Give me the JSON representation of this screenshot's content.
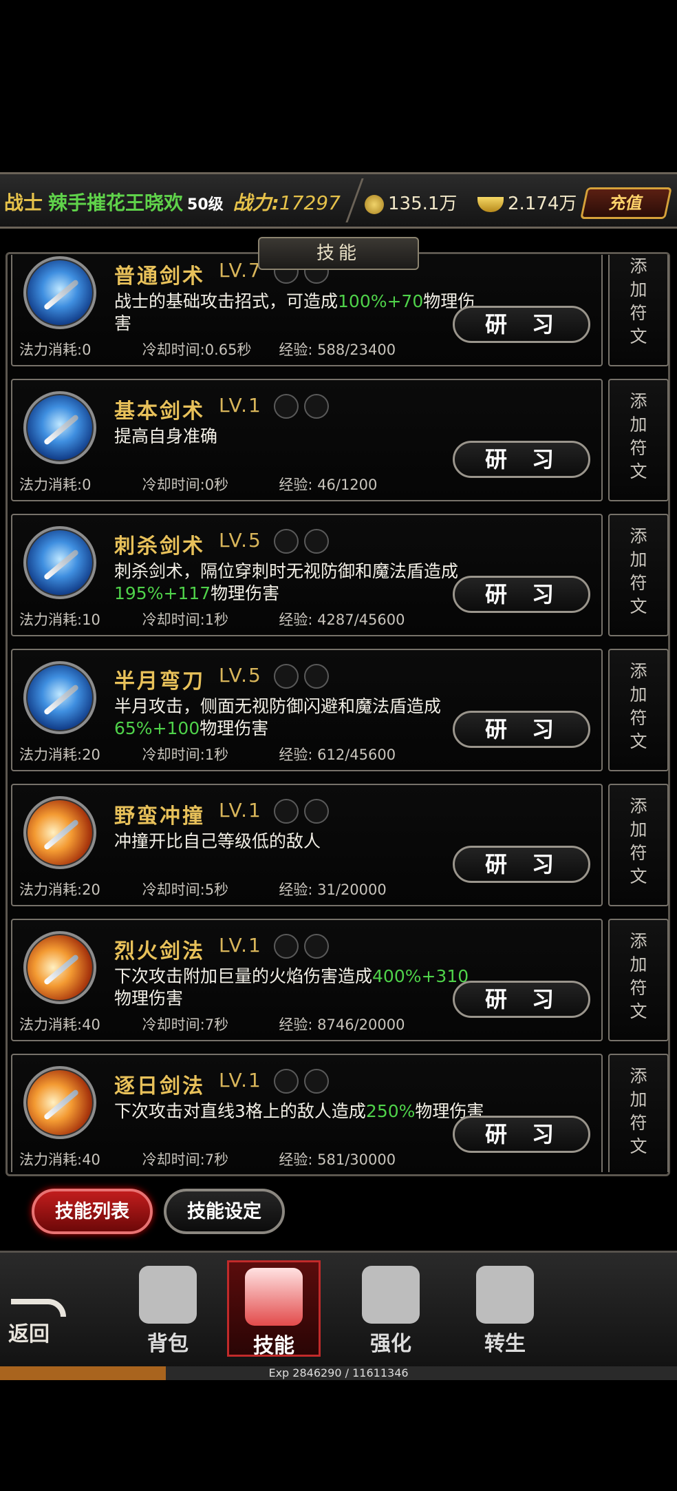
{
  "header": {
    "class_name": "战士",
    "player_name": "辣手摧花王晓欢",
    "level": "50级",
    "power_label": "战力:",
    "power_value": "17297",
    "gold": "135.1万",
    "ingot": "2.174万",
    "recharge_label": "充值"
  },
  "panel_title": "技能",
  "labels": {
    "mp_cost": "法力消耗:",
    "cooldown": "冷却时间:",
    "exp": "经验:",
    "study": "研习",
    "add_rune": "添加符文"
  },
  "skills": [
    {
      "name": "普通剑术",
      "level": "LV.7",
      "desc": [
        {
          "t": "战士的基础攻击招式，可造成"
        },
        {
          "t": "100%+70",
          "g": true
        },
        {
          "t": "物理伤害"
        }
      ],
      "mp": "0",
      "cd": "0.65秒",
      "exp": "588/23400",
      "icon": "blue"
    },
    {
      "name": "基本剑术",
      "level": "LV.1",
      "desc": [
        {
          "t": "提高自身准确"
        }
      ],
      "mp": "0",
      "cd": "0秒",
      "exp": "46/1200",
      "icon": "blue"
    },
    {
      "name": "刺杀剑术",
      "level": "LV.5",
      "desc": [
        {
          "t": "刺杀剑术，隔位穿刺时无视防御和魔法盾造成"
        },
        {
          "t": "195%+117",
          "g": true
        },
        {
          "t": "物理伤害"
        }
      ],
      "mp": "10",
      "cd": "1秒",
      "exp": "4287/45600",
      "icon": "blue"
    },
    {
      "name": "半月弯刀",
      "level": "LV.5",
      "desc": [
        {
          "t": "半月攻击，侧面无视防御闪避和魔法盾造成"
        },
        {
          "t": "65%+100",
          "g": true
        },
        {
          "t": "物理伤害"
        }
      ],
      "mp": "20",
      "cd": "1秒",
      "exp": "612/45600",
      "icon": "blue"
    },
    {
      "name": "野蛮冲撞",
      "level": "LV.1",
      "desc": [
        {
          "t": "冲撞开比自己等级低的敌人"
        }
      ],
      "mp": "20",
      "cd": "5秒",
      "exp": "31/20000",
      "icon": "orange"
    },
    {
      "name": "烈火剑法",
      "level": "LV.1",
      "desc": [
        {
          "t": "下次攻击附加巨量的火焰伤害造成"
        },
        {
          "t": "400%+310",
          "g": true
        },
        {
          "t": "物理伤害"
        }
      ],
      "mp": "40",
      "cd": "7秒",
      "exp": "8746/20000",
      "icon": "orange"
    },
    {
      "name": "逐日剑法",
      "level": "LV.1",
      "desc": [
        {
          "t": "下次攻击对直线3格上的敌人造成"
        },
        {
          "t": "250%",
          "g": true
        },
        {
          "t": "物理伤害"
        }
      ],
      "mp": "40",
      "cd": "7秒",
      "exp": "581/30000",
      "icon": "orange"
    }
  ],
  "tabs": {
    "skill_list": "技能列表",
    "skill_settings": "技能设定"
  },
  "nav": {
    "back": "返回",
    "bag": "背包",
    "skills": "技能",
    "enhance": "强化",
    "rebirth": "转生"
  },
  "exp_bar": {
    "label": "Exp",
    "current": "2846290",
    "total": "11611346",
    "progress": 0.245
  }
}
